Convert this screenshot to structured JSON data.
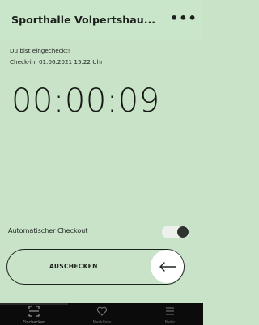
{
  "header": {
    "title": "Sporthalle Volpertshau...",
    "more_icon": "more-horizontal-icon"
  },
  "content": {
    "status_text": "Du bist eingecheckt!",
    "checkin_text": "Check-in: 01.06.2021 15.22 Uhr",
    "timer": "00:00:09",
    "auto_checkout_label": "Automatischer Checkout",
    "auto_checkout_enabled": true,
    "checkout_button_label": "AUSCHECKEN",
    "checkout_arrow_icon": "arrow-left-icon"
  },
  "bottom_nav": {
    "items": [
      {
        "label": "Einchecken",
        "icon": "scan-icon",
        "active": true
      },
      {
        "label": "Merkliste",
        "icon": "heart-icon",
        "active": false
      },
      {
        "label": "Mehr",
        "icon": "menu-icon",
        "active": false
      }
    ]
  },
  "colors": {
    "background": "#c8e3c8",
    "nav_background": "#0b0b0b",
    "text": "#1f231f",
    "toggle_knob": "#2f332f"
  }
}
